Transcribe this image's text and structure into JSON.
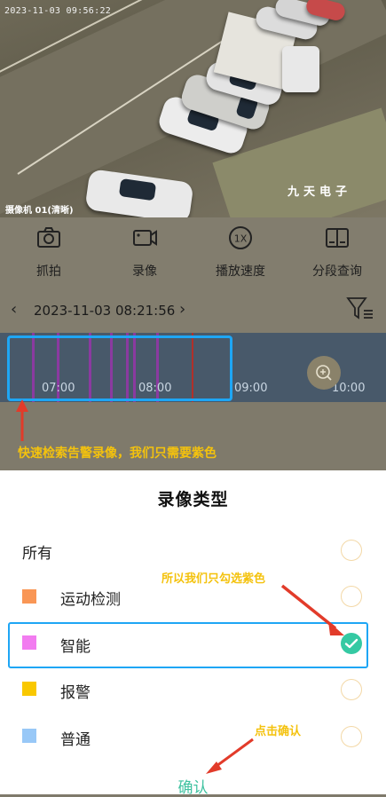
{
  "video": {
    "timestamp": "2023-11-03 09:56:22",
    "camera_label": "摄像机 01(清晰)",
    "watermark": "九天电子"
  },
  "toolbar": {
    "items": [
      {
        "label": "抓拍",
        "icon": "camera-icon"
      },
      {
        "label": "录像",
        "icon": "video-icon"
      },
      {
        "label": "播放速度",
        "icon": "speed-1x-icon"
      },
      {
        "label": "分段查询",
        "icon": "segment-query-icon"
      }
    ]
  },
  "date_row": {
    "prev_icon": "chevron-left-icon",
    "datetime": "2023-11-03 08:21:56",
    "next_icon": "chevron-right-icon",
    "filter_icon": "filter-icon"
  },
  "timeline": {
    "ticks": [
      "07:00",
      "08:00",
      "09:00",
      "10:00"
    ],
    "zoom_icon": "zoom-in-icon",
    "marker_color": "#8b3aa0",
    "cursor_color": "#b0302a"
  },
  "annotations": {
    "timeline_note": "快速检索告警录像，我们只需要紫色",
    "select_note": "所以我们只勾选紫色",
    "confirm_note": "点击确认",
    "highlight_color": "#1ea6f5",
    "note_color": "#f4c20d",
    "arrow_color": "#e23b2a"
  },
  "sheet": {
    "title": "录像类型",
    "options": [
      {
        "label": "所有",
        "color": null,
        "checked": false
      },
      {
        "label": "运动检测",
        "color": "#f99655",
        "checked": false
      },
      {
        "label": "智能",
        "color": "#f27cf0",
        "checked": true
      },
      {
        "label": "报警",
        "color": "#f9c800",
        "checked": false
      },
      {
        "label": "普通",
        "color": "#98c8f7",
        "checked": false
      }
    ],
    "confirm_label": "确认",
    "check_color": "#35c9a3"
  }
}
